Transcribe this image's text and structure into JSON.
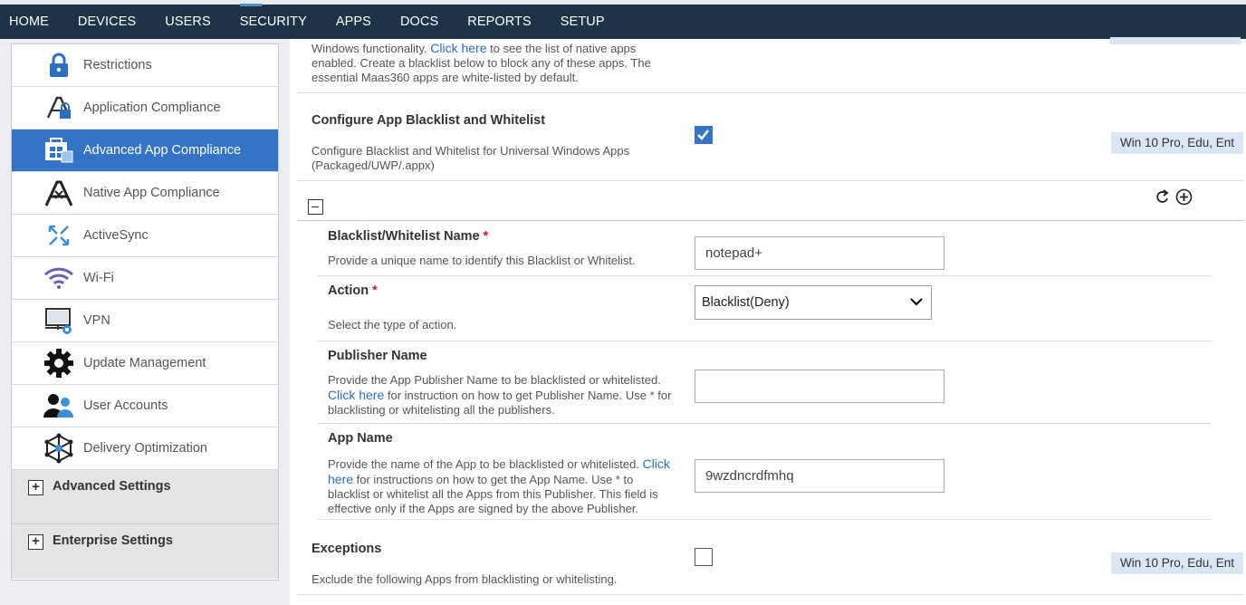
{
  "nav": {
    "items": [
      "HOME",
      "DEVICES",
      "USERS",
      "SECURITY",
      "APPS",
      "DOCS",
      "REPORTS",
      "SETUP"
    ],
    "active": "SECURITY"
  },
  "sidebar": {
    "items": [
      {
        "label": "Restrictions",
        "icon": "lock-icon"
      },
      {
        "label": "Application Compliance",
        "icon": "app-lock-icon"
      },
      {
        "label": "Advanced App Compliance",
        "icon": "windows-store-icon"
      },
      {
        "label": "Native App Compliance",
        "icon": "app-store-icon"
      },
      {
        "label": "ActiveSync",
        "icon": "sync-icon"
      },
      {
        "label": "Wi-Fi",
        "icon": "wifi-icon"
      },
      {
        "label": "VPN",
        "icon": "vpn-icon"
      },
      {
        "label": "Update Management",
        "icon": "gear-icon"
      },
      {
        "label": "User Accounts",
        "icon": "users-icon"
      },
      {
        "label": "Delivery Optimization",
        "icon": "network-icon"
      }
    ],
    "active_index": 2,
    "groups": [
      "Advanced Settings",
      "Enterprise Settings"
    ]
  },
  "main": {
    "intro": {
      "line1_pre": "Windows functionality. ",
      "line1_link": "Click here",
      "line1_post": " to see the list of native apps",
      "line2": "enabled. Create a blacklist below to block any of these apps. The",
      "line3": "essential Maas360 apps are white-listed by default."
    },
    "configure": {
      "title": "Configure App Blacklist and Whitelist",
      "desc_line1": "Configure Blacklist and Whitelist for Universal Windows Apps",
      "desc_line2": "(Packaged/UWP/.appx)",
      "checked": true,
      "badge": "Win 10 Pro, Edu, Ent"
    },
    "list_name": {
      "title": "Blacklist/Whitelist Name",
      "required": "*",
      "desc": "Provide a unique name to identify this Blacklist or Whitelist.",
      "value": "notepad+"
    },
    "action": {
      "title": "Action",
      "required": "*",
      "desc": "Select the type of action.",
      "selected": "Blacklist(Deny)"
    },
    "publisher": {
      "title": "Publisher Name",
      "desc_line1": "Provide the App Publisher Name to be blacklisted or whitelisted.",
      "desc_line2_link": "Click here",
      "desc_line2_post": " for instruction on how to get Publisher Name. Use * for",
      "desc_line3": "blacklisting or whitelisting all the publishers.",
      "value": ""
    },
    "app_name": {
      "title": "App Name",
      "desc_line1_pre": "Provide the name of the App to be blacklisted or whitelisted. ",
      "desc_line1_link": "Click",
      "desc_line2_link": "here",
      "desc_line2_post": " for instructions on how to get the App Name. Use * to",
      "desc_line3": "blacklist or whitelist all the Apps from this Publisher. This field is",
      "desc_line4": "effective only if the Apps are signed by the above Publisher.",
      "value": "9wzdncrdfmhq"
    },
    "exceptions": {
      "title": "Exceptions",
      "desc": "Exclude the following Apps from blacklisting or whitelisting.",
      "checked": false,
      "badge": "Win 10 Pro, Edu, Ent"
    }
  }
}
